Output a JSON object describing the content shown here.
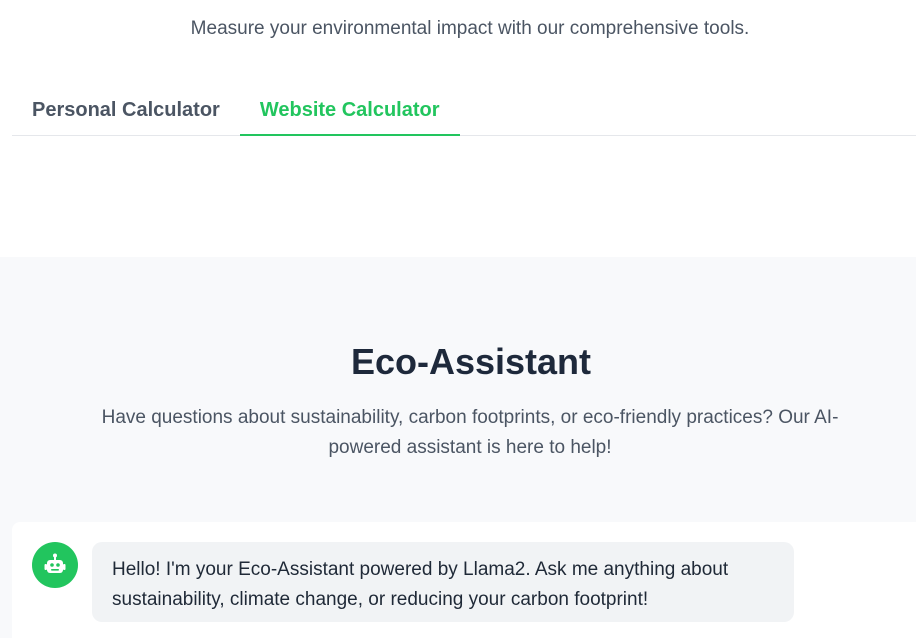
{
  "calculator": {
    "subtitle": "Measure your environmental impact with our comprehensive tools.",
    "tabs": [
      {
        "label": "Personal Calculator",
        "active": false
      },
      {
        "label": "Website Calculator",
        "active": true
      }
    ]
  },
  "assistant": {
    "title": "Eco-Assistant",
    "description": "Have questions about sustainability, carbon footprints, or eco-friendly practices? Our AI-powered assistant is here to help!",
    "messages": [
      {
        "sender_icon": "robot-icon",
        "text": "Hello! I'm your Eco-Assistant powered by Llama2. Ask me anything about sustainability, climate change, or reducing your carbon footprint!"
      }
    ]
  },
  "colors": {
    "accent": "#22c55e",
    "section_bg": "#f8f9fb",
    "bubble_bg": "#f1f3f5",
    "heading": "#1e293b",
    "muted_text": "#4b5563"
  }
}
